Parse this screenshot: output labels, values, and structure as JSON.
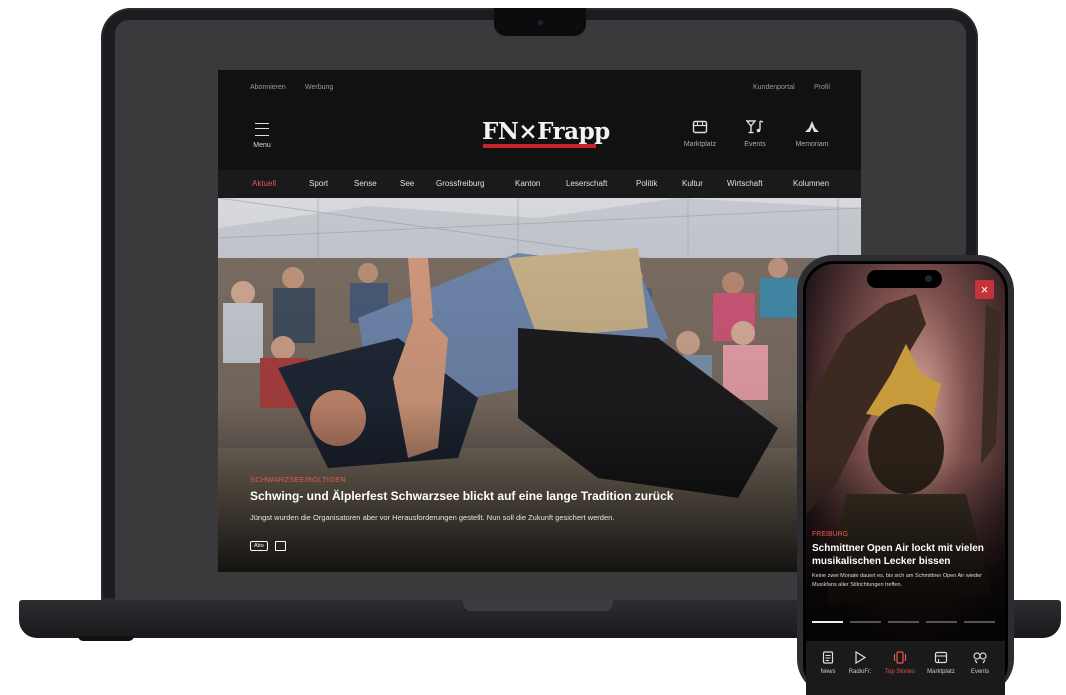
{
  "website": {
    "top_links_left": [
      "Abonnieren",
      "Werbung"
    ],
    "top_links_right": [
      "Kundenportal",
      "Profil"
    ],
    "menu_label": "Menu",
    "logo_text": "FN×Frapp",
    "utilities": [
      {
        "label": "Marktplatz",
        "icon": "storefront-icon"
      },
      {
        "label": "Events",
        "icon": "cocktail-music-icon"
      },
      {
        "label": "Memoriam",
        "icon": "praying-hands-icon"
      }
    ],
    "nav": [
      "Aktuell",
      "Sport",
      "Sense",
      "See",
      "Grossfreiburg",
      "Kanton",
      "Leserschaft",
      "Politik",
      "Kultur",
      "Wirtschaft",
      "Kolumnen"
    ],
    "active_nav": "Aktuell",
    "hero": {
      "kicker": "Schwarzsee/Boltigen",
      "headline": "Schwing- und Älplerfest Schwarzsee blickt auf eine lange Tradition zurück",
      "lead": "Jüngst wurden die Organisatoren aber vor Herausforderungen gestellt. Nun soll die Zukunft gesichert werden.",
      "badge": "Abo"
    }
  },
  "phone": {
    "story": {
      "kicker": "Freiburg",
      "headline": "Schmittner Open Air lockt mit vielen musikalischen Lecker bissen",
      "lead": "Keine zwei Monate dauert es, bis sich am Schmittner Open Air wieder Musikfans aller Stilrichtungen treffen."
    },
    "close_icon": "close-icon",
    "progress_active_index": 0,
    "progress_count": 5,
    "tabs": [
      {
        "label": "News",
        "icon": "document-icon"
      },
      {
        "label": "RadioFr.",
        "icon": "play-icon"
      },
      {
        "label": "Top Stories",
        "icon": "stories-icon"
      },
      {
        "label": "Marktplatz",
        "icon": "storefront-icon"
      },
      {
        "label": "Events",
        "icon": "cocktail-music-icon"
      }
    ],
    "active_tab": "Top Stories"
  },
  "colors": {
    "accent": "#e8564f",
    "logo_underline": "#c8232d",
    "background_dark": "#151515"
  }
}
